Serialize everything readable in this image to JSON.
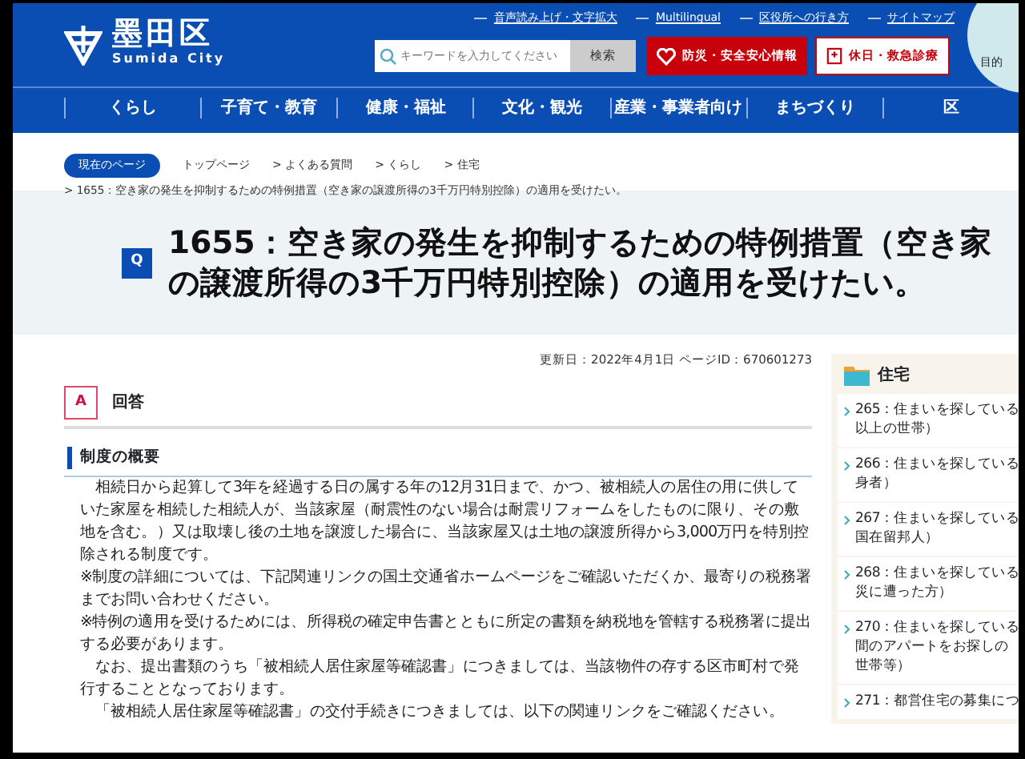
{
  "header": {
    "logo_name": "墨田区",
    "logo_sub": "Sumida City",
    "util_links": [
      "音声読み上げ・文字拡大",
      "Multilingual",
      "区役所への行き方",
      "サイトマップ"
    ],
    "search": {
      "placeholder": "キーワードを入力してください",
      "button": "検索"
    },
    "buttons": [
      {
        "label": "防災・安全安心情報",
        "kind": "emergency"
      },
      {
        "label": "休日・救急診療",
        "kind": "medical"
      }
    ],
    "purpose": "目的"
  },
  "nav": [
    "くらし",
    "子育て・教育",
    "健康・福祉",
    "文化・観光",
    "産業・事業者向け",
    "まちづくり",
    "区"
  ],
  "breadcrumb": {
    "label": "現在のページ",
    "separator": ">",
    "links": [
      "トップページ",
      "よくある質問",
      "くらし",
      "住宅"
    ],
    "current": "1655：空き家の発生を抑制するための特例措置（空き家の譲渡所得の3千万円特別控除）の適用を受けたい。"
  },
  "question": {
    "mark": "Q",
    "title_lines": [
      "1655：空き家の発生を抑制するための特例措置（空き家",
      "の譲渡所得の3千万円特別控除）の適用を受けたい。"
    ]
  },
  "meta": "更新日：2022年4月1日 ページID：670601273",
  "answer": {
    "mark": "A",
    "heading": "回答"
  },
  "section": {
    "heading": "制度の概要",
    "paragraphs": [
      "　相続日から起算して3年を経過する日の属する年の12月31日まで、かつ、被相続人の居住の用に供していた家屋を相続した相続人が、当該家屋（耐震性のない場合は耐震リフォームをしたものに限り、その敷地を含む。）又は取壊し後の土地を譲渡した場合に、当該家屋又は土地の譲渡所得から3,000万円を特別控除される制度です。",
      "※制度の詳細については、下記関連リンクの国土交通省ホームページをご確認いただくか、最寄りの税務署までお問い合わせください。",
      "※特例の適用を受けるためには、所得税の確定申告書とともに所定の書類を納税地を管轄する税務署に提出する必要があります。",
      "　なお、提出書類のうち「被相続人居住家屋等確認書」につきましては、当該物件の存する区市町村で発行することとなっております。",
      "　「被相続人居住家屋等確認書」の交付手続きにつきましては、以下の関連リンクをご確認ください。"
    ]
  },
  "sidebar": {
    "heading": "住宅",
    "items": [
      {
        "lines": [
          "265：住まいを探している",
          "以上の世帯）"
        ]
      },
      {
        "lines": [
          "266：住まいを探している",
          "身者）"
        ]
      },
      {
        "lines": [
          "267：住まいを探している",
          "国在留邦人）"
        ]
      },
      {
        "lines": [
          "268：住まいを探している",
          "災に遭った方）"
        ]
      },
      {
        "lines": [
          "270：住まいを探している",
          "間のアパートをお探しの",
          "世帯等）"
        ]
      },
      {
        "lines": [
          "271：都営住宅の募集につ"
        ]
      }
    ]
  }
}
